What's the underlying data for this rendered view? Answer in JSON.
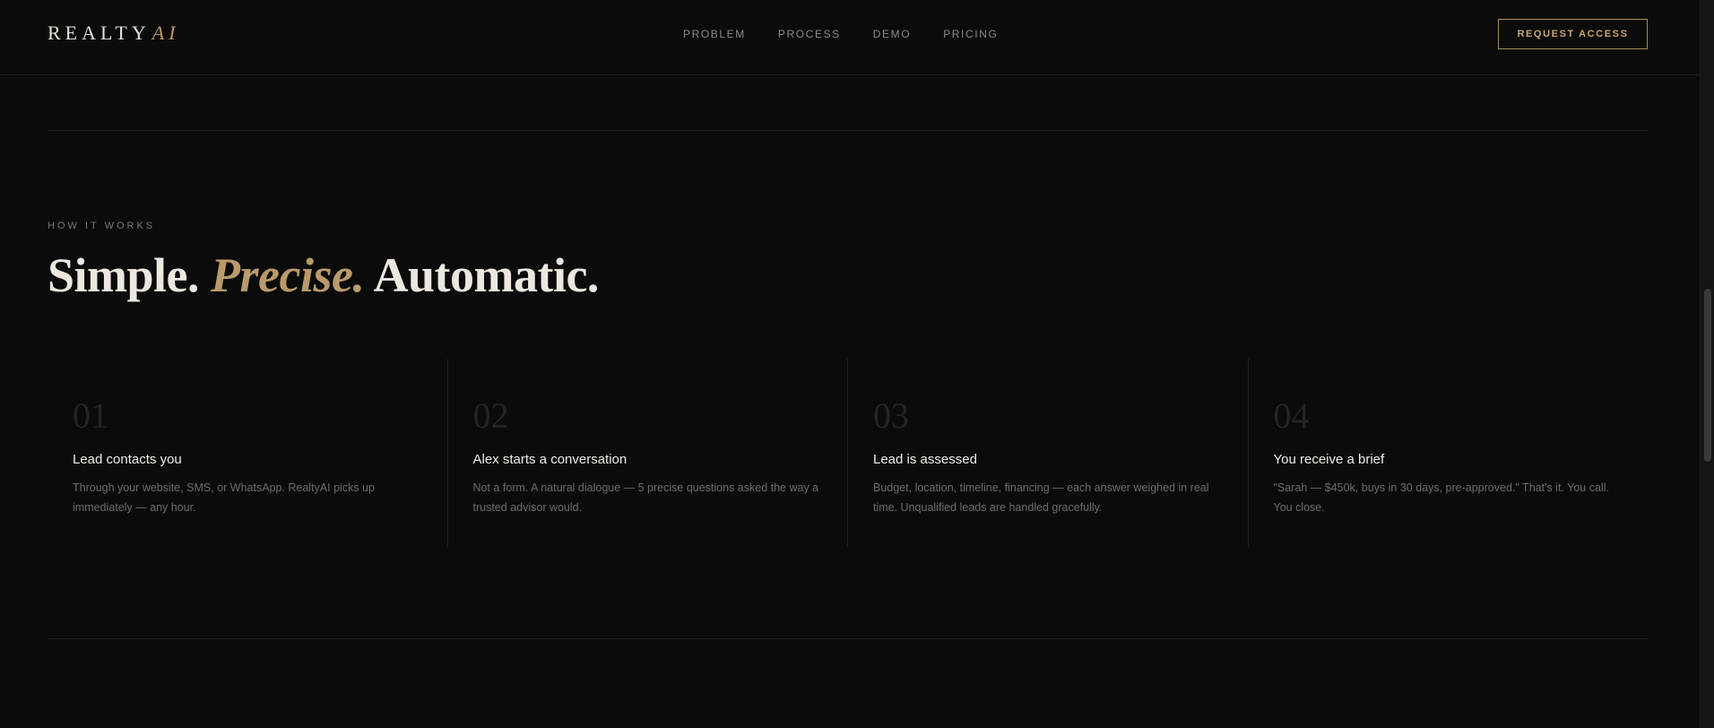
{
  "header": {
    "logo_main": "REALTY",
    "logo_accent": "AI",
    "nav": [
      "PROBLEM",
      "PROCESS",
      "DEMO",
      "PRICING"
    ],
    "cta_label": "REQUEST ACCESS"
  },
  "section": {
    "eyebrow": "HOW IT WORKS",
    "headline_part1": "Simple. ",
    "headline_part2": "Precise.",
    "headline_part3": " Automatic.",
    "steps": [
      {
        "num": "01",
        "title": "Lead contacts you",
        "desc": "Through your website, SMS, or WhatsApp. RealtyAI picks up immediately — any hour."
      },
      {
        "num": "02",
        "title": "Alex starts a conversation",
        "desc": "Not a form. A natural dialogue — 5 precise questions asked the way a trusted advisor would."
      },
      {
        "num": "03",
        "title": "Lead is assessed",
        "desc": "Budget, location, timeline, financing — each answer weighed in real time. Unqualified leads are handled gracefully."
      },
      {
        "num": "04",
        "title": "You receive a brief",
        "desc": "\"Sarah — $450k, buys in 30 days, pre-approved.\" That's it. You call. You close."
      }
    ]
  },
  "colors": {
    "background": "#0b0b0b",
    "accent_gold": "#b99a6a",
    "text_primary": "#ece8e0",
    "text_muted": "#6f6c67"
  }
}
